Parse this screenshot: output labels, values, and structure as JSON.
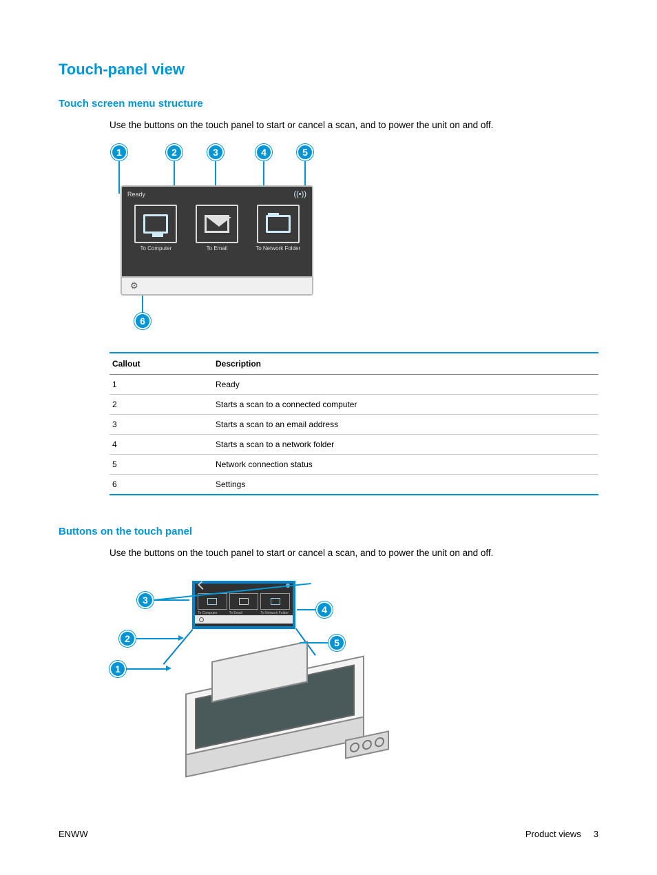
{
  "headings": {
    "h1": "Touch-panel view",
    "h2a": "Touch screen menu structure",
    "h2b": "Buttons on the touch panel"
  },
  "intro_a": "Use the buttons on the touch panel to start or cancel a scan, and to power the unit on and off.",
  "intro_b": "Use the buttons on the touch panel to start or cancel a scan, and to power the unit on and off.",
  "panel": {
    "status": "Ready",
    "tiles": {
      "computer": "To Computer",
      "email": "To Email",
      "folder": "To Network Folder"
    }
  },
  "table": {
    "head": {
      "col1": "Callout",
      "col2": "Description"
    },
    "rows": [
      {
        "n": "1",
        "d": "Ready"
      },
      {
        "n": "2",
        "d": "Starts a scan to a connected computer"
      },
      {
        "n": "3",
        "d": "Starts a scan to an email address"
      },
      {
        "n": "4",
        "d": "Starts a scan to a network folder"
      },
      {
        "n": "5",
        "d": "Network connection status"
      },
      {
        "n": "6",
        "d": "Settings"
      }
    ]
  },
  "fig1_badges": {
    "b1": "1",
    "b2": "2",
    "b3": "3",
    "b4": "4",
    "b5": "5",
    "b6": "6"
  },
  "fig2_badges": {
    "b1": "1",
    "b2": "2",
    "b3": "3",
    "b4": "4",
    "b5": "5"
  },
  "footer": {
    "left": "ENWW",
    "section": "Product views",
    "page": "3"
  }
}
